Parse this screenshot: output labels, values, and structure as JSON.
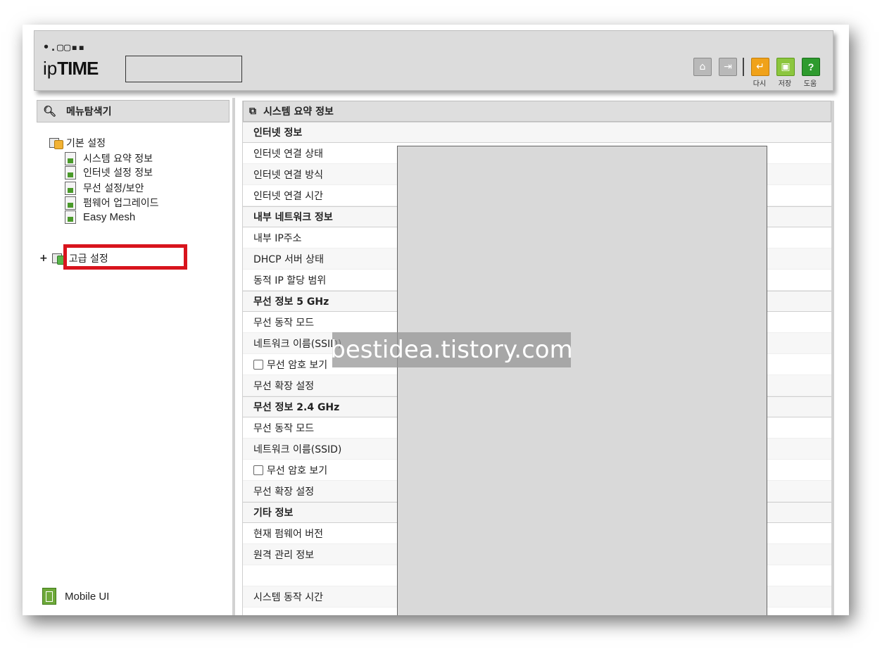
{
  "header": {
    "logo_dots": "•.▢▢▪▪",
    "logo_ip": "ip",
    "logo_time": "TIME",
    "toolbar": {
      "home_icon": "home-icon",
      "logout_icon": "logout-icon",
      "reload_label": "다시",
      "save_label": "저장",
      "help_label": "도움",
      "help_glyph": "?"
    }
  },
  "left": {
    "title": "메뉴탐색기",
    "basic_settings": "기본 설정",
    "items": [
      {
        "label": "시스템 요약 정보"
      },
      {
        "label": "인터넷 설정 정보"
      },
      {
        "label": "무선 설정/보안"
      },
      {
        "label": "펌웨어 업그레이드"
      },
      {
        "label": "Easy Mesh"
      }
    ],
    "advanced_expand": "+",
    "advanced_settings": "고급 설정",
    "mobile_ui": "Mobile UI"
  },
  "right": {
    "title": "시스템 요약 정보",
    "rows": [
      {
        "label": "인터넷 정보",
        "section": true
      },
      {
        "label": "인터넷 연결 상태"
      },
      {
        "label": "인터넷 연결 방식"
      },
      {
        "label": "인터넷 연결 시간"
      },
      {
        "label": "내부 네트워크 정보",
        "section": true
      },
      {
        "label": "내부 IP주소"
      },
      {
        "label": "DHCP 서버 상태"
      },
      {
        "label": "동적 IP 할당 범위"
      },
      {
        "label": "무선 정보 5 GHz",
        "section": true
      },
      {
        "label": "무선 동작 모드"
      },
      {
        "label": "네트워크 이름(SSID)"
      },
      {
        "label": "무선 암호 보기",
        "checkbox": true
      },
      {
        "label": "무선 확장 설정"
      },
      {
        "label": "무선 정보 2.4 GHz",
        "section": true
      },
      {
        "label": "무선 동작 모드"
      },
      {
        "label": "네트워크 이름(SSID)"
      },
      {
        "label": "무선 암호 보기",
        "checkbox": true
      },
      {
        "label": "무선 확장 설정"
      },
      {
        "label": "기타 정보",
        "section": true
      },
      {
        "label": "현재 펌웨어 버전"
      },
      {
        "label": "원격 관리 정보"
      },
      {
        "label": ""
      },
      {
        "label": "시스템 동작 시간"
      }
    ]
  },
  "watermark": "bestidea.tistory.com"
}
